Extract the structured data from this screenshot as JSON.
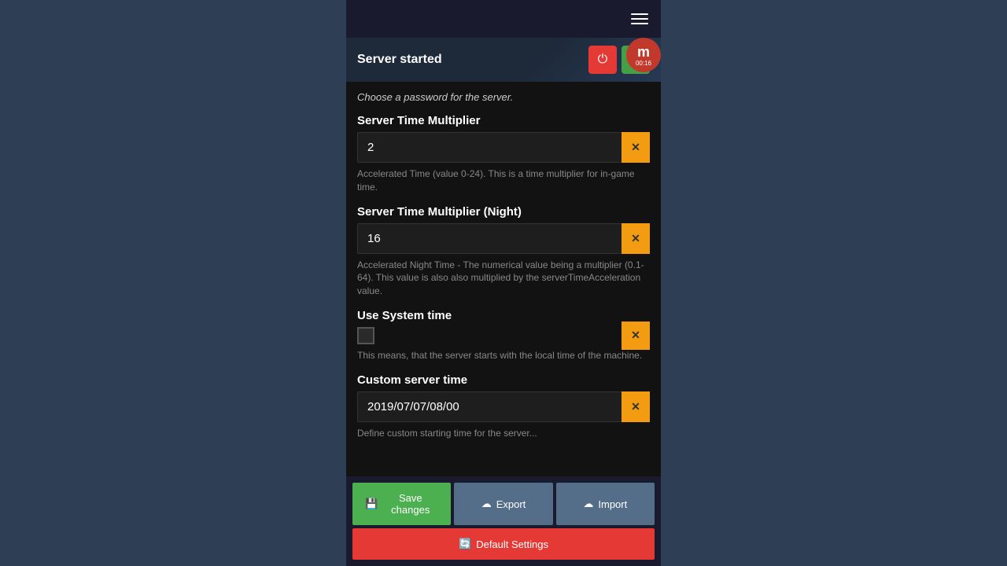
{
  "header": {
    "server_status": "Server started",
    "power_icon": "⏻",
    "restart_icon": "↻"
  },
  "avatar": {
    "letter": "m",
    "timer": "00:16"
  },
  "top_description": "Choose a password for the server.",
  "fields": {
    "server_time_multiplier": {
      "label": "Server Time Multiplier",
      "value": "2",
      "description": "Accelerated Time (value 0-24). This is a time multiplier for in-game time."
    },
    "server_time_multiplier_night": {
      "label": "Server Time Multiplier (Night)",
      "value": "16",
      "description": "Accelerated Night Time - The numerical value being a multiplier (0.1-64). This value is also also multiplied by the serverTimeAcceleration value."
    },
    "use_system_time": {
      "label": "Use System time",
      "checked": false,
      "description": "This means, that the server starts with the local time of the machine."
    },
    "custom_server_time": {
      "label": "Custom server time",
      "value": "2019/07/07/08/00",
      "description": "Define custom starting time for the server..."
    }
  },
  "buttons": {
    "save_changes": "Save changes",
    "export": "Export",
    "import": "Import",
    "default_settings": "Default Settings",
    "save_icon": "💾",
    "export_icon": "☁",
    "import_icon": "☁",
    "default_icon": "🔄"
  }
}
